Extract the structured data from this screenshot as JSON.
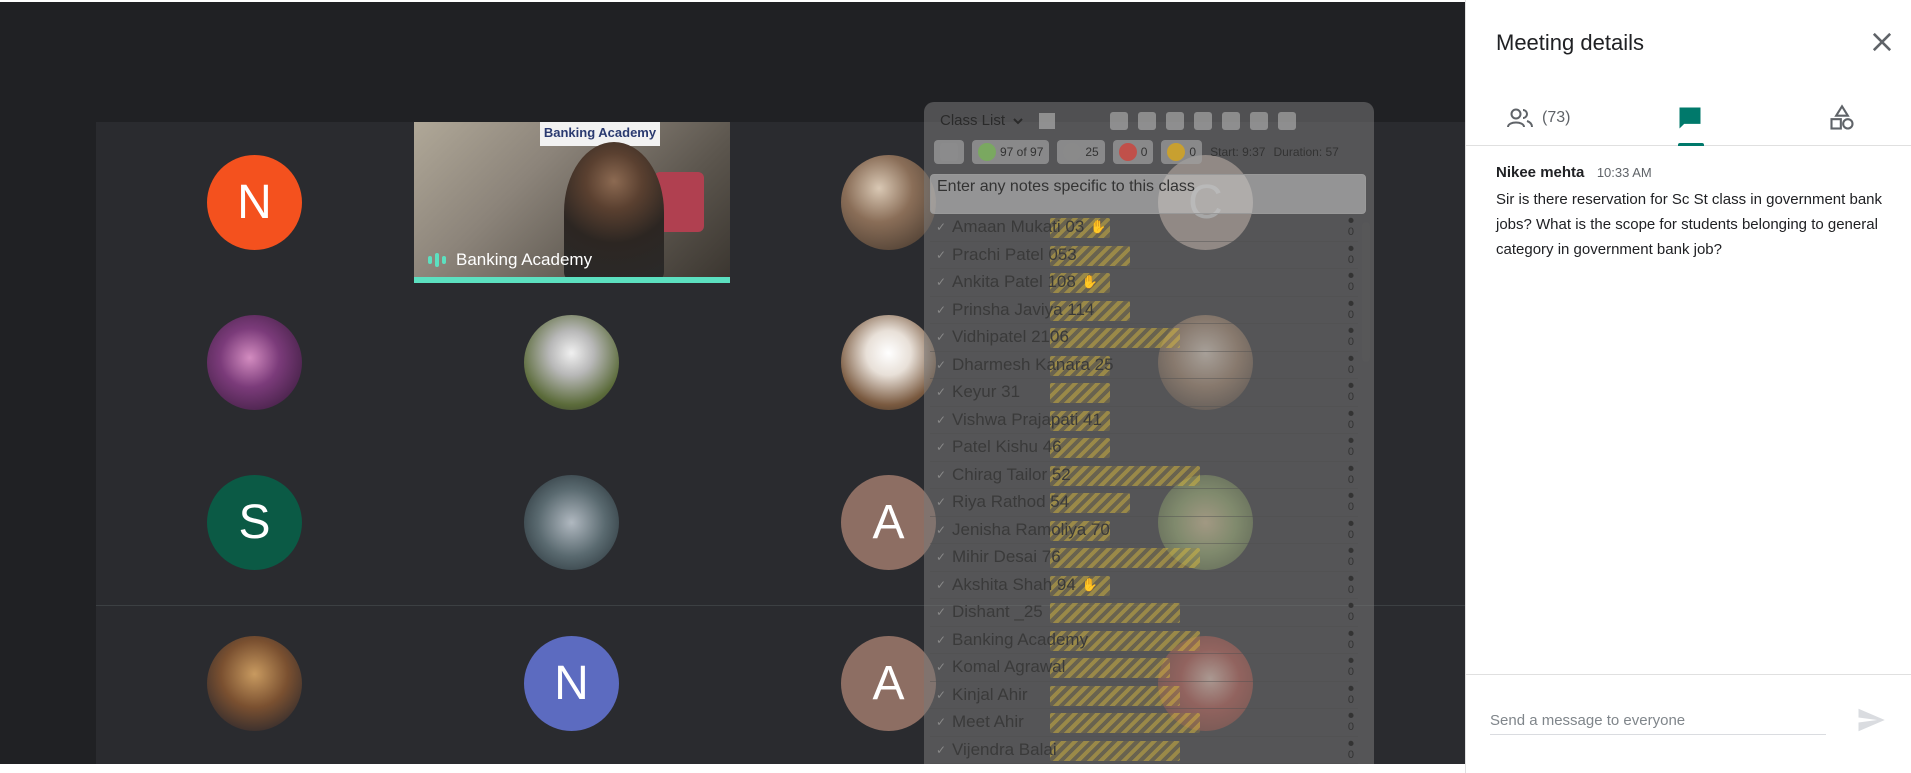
{
  "video": {
    "name": "Banking Academy",
    "sign_text": "Banking Academy"
  },
  "tiles": {
    "n1": "N",
    "s": "S",
    "a1": "A",
    "a2": "A",
    "n2": "N",
    "c": "C"
  },
  "tile_colors": {
    "n1": "#f4511e",
    "s": "#0b5a45",
    "a": "#8d6e63",
    "n2": "#5c6bc0",
    "c": "#c7b3a8"
  },
  "classlist": {
    "title": "Class List",
    "present": "97 of 97",
    "hands": "25",
    "absent": "0",
    "other": "0",
    "start": "Start: 9:37",
    "duration": "Duration: 57",
    "notes_placeholder": "Enter any notes specific to this class",
    "students": [
      {
        "name": "Amaan Mukati 03",
        "hand": true
      },
      {
        "name": "Prachi Patel 053",
        "hand": false
      },
      {
        "name": "Ankita Patel 108",
        "hand": true
      },
      {
        "name": "Prinsha Javiya 114",
        "hand": false
      },
      {
        "name": "Vidhipatel 2106",
        "hand": false
      },
      {
        "name": "Dharmesh Kanara 25",
        "hand": false
      },
      {
        "name": "Keyur 31",
        "hand": false
      },
      {
        "name": "Vishwa Prajapati 41",
        "hand": false
      },
      {
        "name": "Patel Kishu 46",
        "hand": false
      },
      {
        "name": "Chirag Tailor 52",
        "hand": false
      },
      {
        "name": "Riya Rathod 54",
        "hand": false
      },
      {
        "name": "Jenisha Ramoliya 70",
        "hand": false
      },
      {
        "name": "Mihir Desai 76",
        "hand": false
      },
      {
        "name": "Akshita Shah 94",
        "hand": true
      },
      {
        "name": "Dishant _25",
        "hand": false
      },
      {
        "name": "Banking Academy",
        "hand": false
      },
      {
        "name": "Komal Agrawal",
        "hand": false
      },
      {
        "name": "Kinjal Ahir",
        "hand": false
      },
      {
        "name": "Meet Ahir",
        "hand": false
      },
      {
        "name": "Vijendra Balai",
        "hand": false
      }
    ],
    "row_count": "0"
  },
  "panel": {
    "title": "Meeting details",
    "people_count": "(73)"
  },
  "message": {
    "sender": "Nikee mehta",
    "time": "10:33 AM",
    "text": "Sir is there reservation for Sc St class in government bank jobs? What is the scope for students belonging to general category in government bank job?"
  },
  "compose": {
    "placeholder": "Send a message to everyone"
  },
  "colors": {
    "accent": "#00796b",
    "speaking": "#5ce0c0"
  }
}
